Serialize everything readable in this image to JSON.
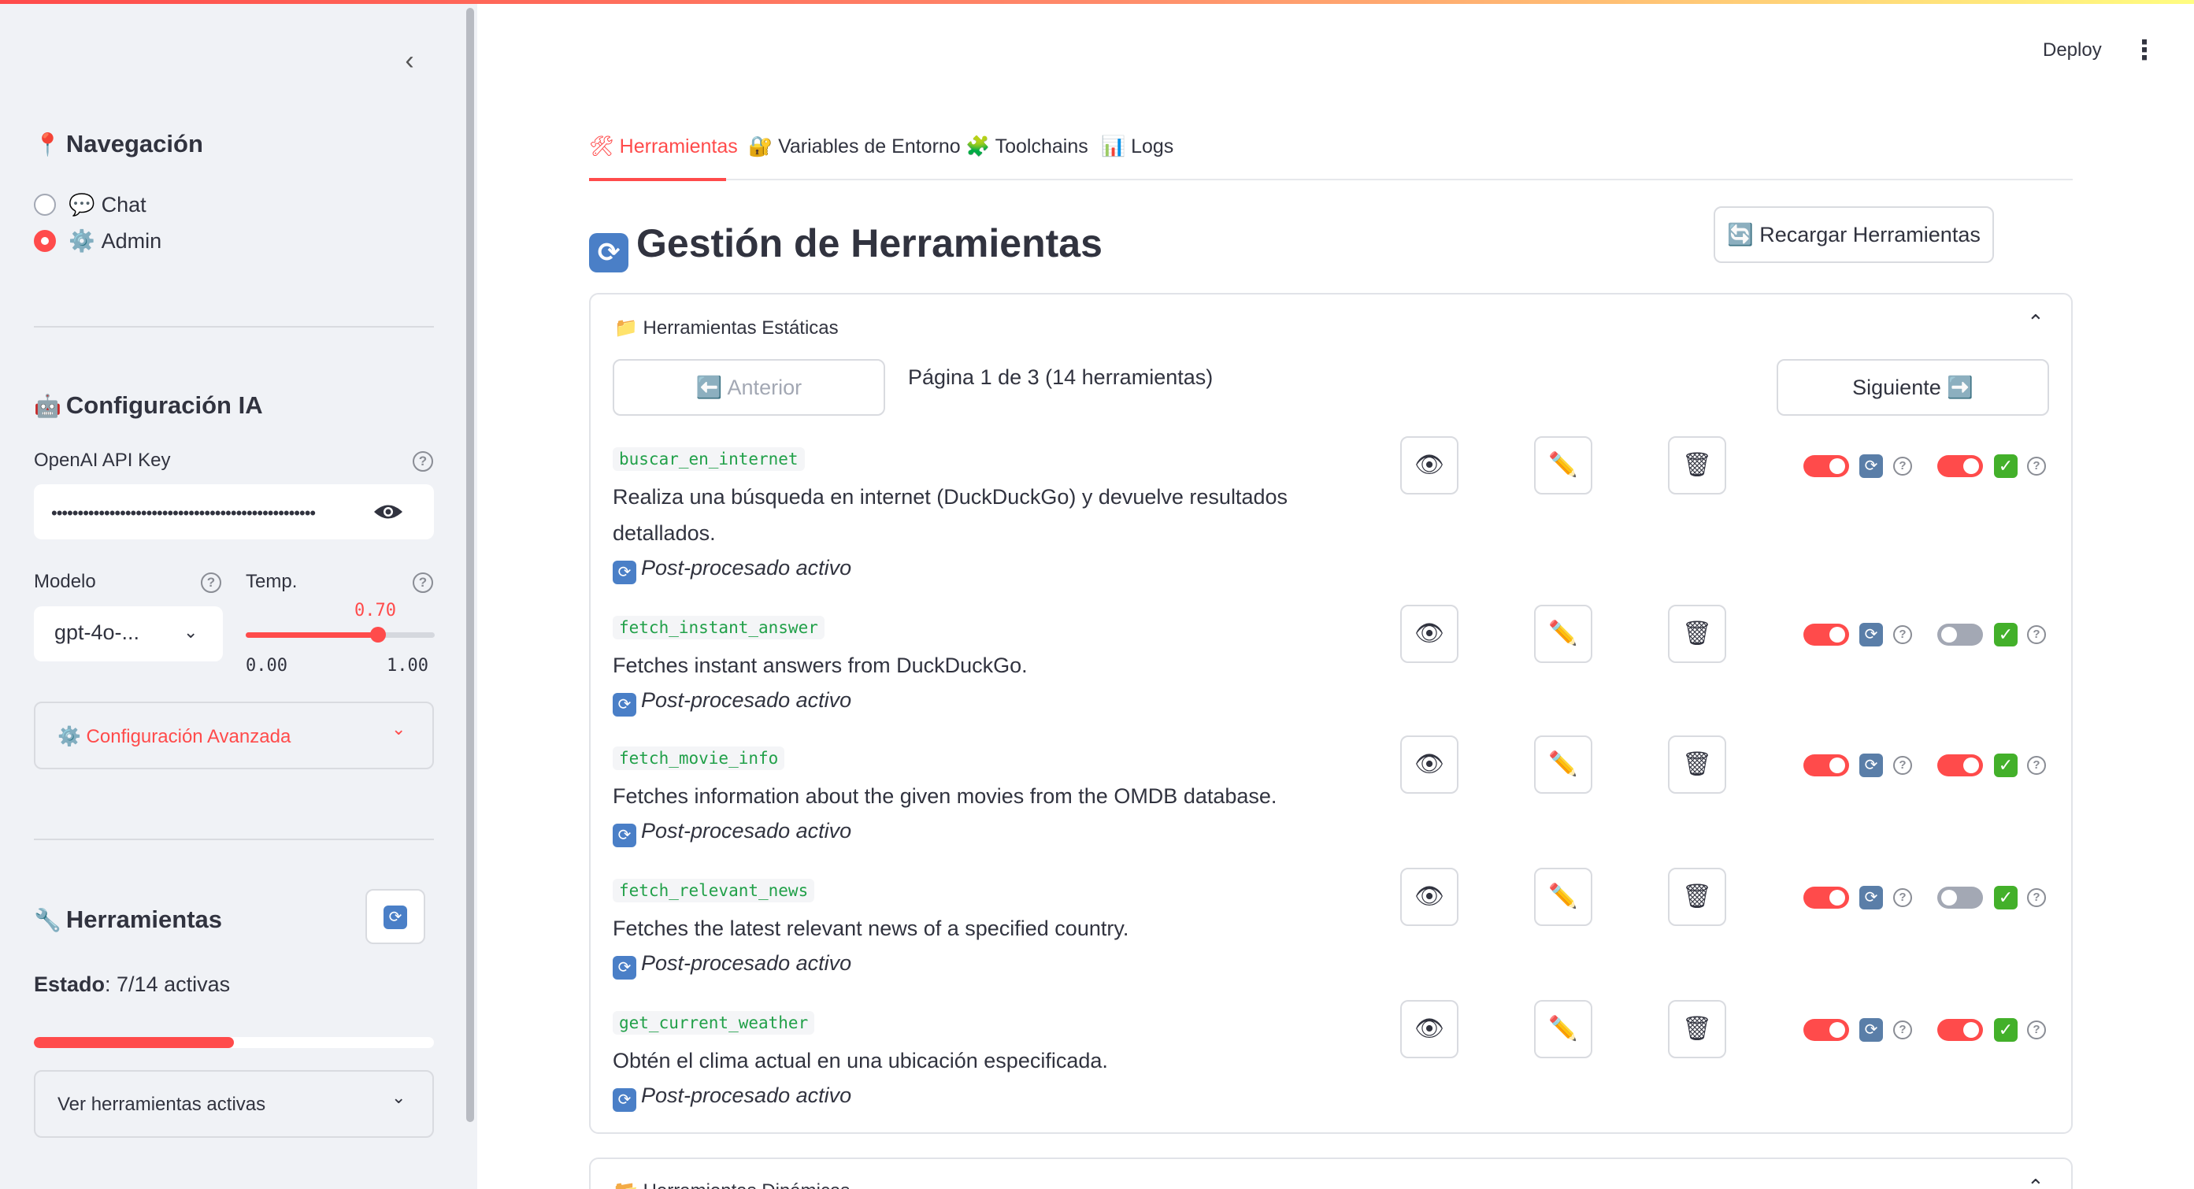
{
  "sidebar": {
    "nav_title": "Navegación",
    "nav_icon": "📍",
    "nav_options": [
      {
        "icon": "💬",
        "label": "Chat",
        "selected": false
      },
      {
        "icon": "⚙️",
        "label": "Admin",
        "selected": true
      }
    ],
    "ai_title": "Configuración IA",
    "ai_icon": "🤖",
    "api_key_label": "OpenAI API Key",
    "api_key_value": "••••••••••••••••••••••••••••••••••••••••••••••••••",
    "model_label": "Modelo",
    "model_value": "gpt-4o-...",
    "temp_label": "Temp.",
    "temp_value": "0.70",
    "temp_min": "0.00",
    "temp_max": "1.00",
    "temp_fraction": 0.7,
    "advanced_label": "⚙️ Configuración Avanzada",
    "tools_title": "Herramientas",
    "tools_icon": "🔧",
    "status_label": "Estado",
    "status_value": ": 7/14 activas",
    "progress_fraction": 0.5,
    "view_active_label": "Ver herramientas activas"
  },
  "header": {
    "deploy_label": "Deploy"
  },
  "tabs": [
    {
      "label": "🛠 Herramientas",
      "active": true
    },
    {
      "label": "🔐 Variables de Entorno",
      "active": false
    },
    {
      "label": "🧩 Toolchains",
      "active": false
    },
    {
      "label": "📊 Logs",
      "active": false
    }
  ],
  "main": {
    "title_icon": "🔄",
    "title": "Gestión de Herramientas",
    "reload_label": "🔄 Recargar Herramientas",
    "static_section_label": "📁 Herramientas Estáticas",
    "prev_label": "⬅️ Anterior",
    "next_label": "Siguiente ➡️",
    "page_info": "Página 1 de 3 (14 herramientas)",
    "postproc_label": "Post-procesado activo",
    "dynamic_section_label": "Herramientas Dinámicas"
  },
  "tools": [
    {
      "name": "buscar_en_internet",
      "desc": "Realiza una búsqueda en internet (DuckDuckGo) y devuelve resultados detallados.",
      "toggle1": true,
      "toggle2": true
    },
    {
      "name": "fetch_instant_answer",
      "desc": "Fetches instant answers from DuckDuckGo.",
      "toggle1": true,
      "toggle2": false
    },
    {
      "name": "fetch_movie_info",
      "desc": "Fetches information about the given movies from the OMDB database.",
      "toggle1": true,
      "toggle2": true
    },
    {
      "name": "fetch_relevant_news",
      "desc": "Fetches the latest relevant news of a specified country.",
      "toggle1": true,
      "toggle2": false
    },
    {
      "name": "get_current_weather",
      "desc": "Obtén el clima actual en una ubicación especificada.",
      "toggle1": true,
      "toggle2": true
    }
  ],
  "colors": {
    "accent": "#ff4b4b",
    "sidebar_bg": "#f0f2f6",
    "code_green": "#21a049"
  }
}
